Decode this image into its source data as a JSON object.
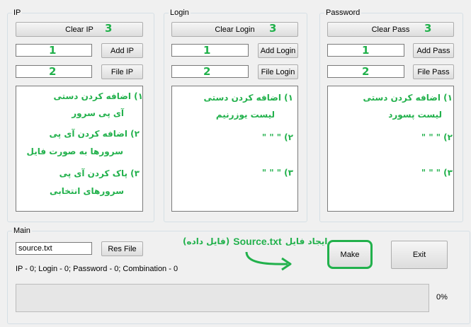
{
  "ip": {
    "title": "IP",
    "clear": "Clear IP",
    "add": "Add IP",
    "file": "File IP",
    "input_value": "",
    "file_value": ""
  },
  "login": {
    "title": "Login",
    "clear": "Clear Login",
    "add": "Add Login",
    "file": "File Login",
    "input_value": "",
    "file_value": ""
  },
  "password": {
    "title": "Password",
    "clear": "Clear Pass",
    "add": "Add Pass",
    "file": "File Pass",
    "input_value": "",
    "file_value": ""
  },
  "main": {
    "title": "Main",
    "source_value": "source.txt",
    "res_file": "Res File",
    "status": "IP - 0; Login - 0; Password - 0; Combination - 0",
    "make": "Make",
    "exit": "Exit",
    "progress_percent_label": "0%",
    "progress_fraction": 0
  },
  "annotations": {
    "n1": "1",
    "n2": "2",
    "n3": "3",
    "ip_note1_line1": "۱) اضافه کردن دستی",
    "ip_note1_line2": "آی پی سرور",
    "ip_note2_line1": "۲) اضافه کردن آی پی",
    "ip_note2_line2": "سرورها به صورت فایل",
    "ip_note3_line1": "۳) پاک کردن آی پی",
    "ip_note3_line2": "سرورهای انتخابی",
    "login_note1_line1": "۱) اضافه کردن دستی",
    "login_note1_line2": "لیست یوزرنیم",
    "pass_note1_line1": "۱) اضافه کردن دستی",
    "pass_note1_line2": "لیست پسورد",
    "note2_same": "۲) \" \" \"",
    "note3_same": "۳) \" \" \"",
    "make_note_prefix": "ایجاد فایل",
    "make_note_file": "Source.txt",
    "make_note_suffix": "(فایل داده)"
  },
  "colors": {
    "annotation": "#22b14c",
    "progress_fill": "#06b025"
  }
}
